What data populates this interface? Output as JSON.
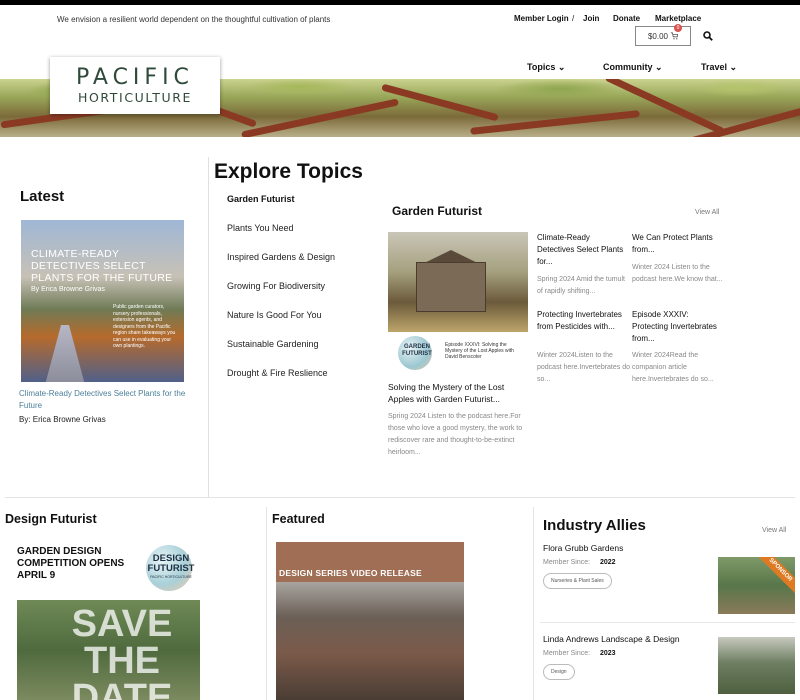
{
  "header": {
    "tagline": "We envision a resilient world dependent on the thoughtful cultivation of plants",
    "account": {
      "login": "Member Login",
      "separator": "/",
      "join": "Join",
      "donate": "Donate",
      "marketplace": "Marketplace"
    },
    "cart": {
      "amount": "$0.00",
      "count": "0",
      "icon": "cart-icon"
    },
    "search_icon": "search-icon"
  },
  "logo": {
    "line1": "PACIFIC",
    "line2": "HORTICULTURE"
  },
  "nav": [
    {
      "label": "Topics ⌄"
    },
    {
      "label": "Community ⌄"
    },
    {
      "label": "Travel ⌄"
    }
  ],
  "latest": {
    "heading": "Latest",
    "image": {
      "headline": "CLIMATE-READY DETECTIVES SELECT PLANTS FOR THE FUTURE",
      "byline": "By Erica Browne Grivas",
      "blurb": "Public garden curators, nursery professionals, extension agents, and designers from the Pacific region share takeaways you can use in evaluating your own plantings."
    },
    "title": "Climate-Ready Detectives Select Plants for the Future",
    "author": "By: Erica Browne Grivas"
  },
  "explore": {
    "heading": "Explore Topics",
    "topics": [
      "Garden Futurist",
      "Plants You Need",
      "Inspired Gardens & Design",
      "Growing For Biodiversity",
      "Nature Is Good For You",
      "Sustainable Gardening",
      "Drought & Fire Reslience"
    ]
  },
  "garden_futurist": {
    "heading": "Garden Futurist",
    "view_all": "View All",
    "main": {
      "episode_logo": "GARDEN FUTURIST",
      "episode_caption": "Episode XXXVI: Solving the Mystery of the Lost Apples with David Benscoter",
      "title": "Solving the Mystery of the Lost Apples with Garden Futurist...",
      "excerpt": "Spring 2024 Listen to the podcast here.For those who love a good mystery, the work to rediscover rare and thought-to-be-extinct heirloom..."
    },
    "items": [
      {
        "title": "Climate-Ready Detectives Select Plants for...",
        "excerpt": "Spring 2024 Amid the tumult of rapidly shifting..."
      },
      {
        "title": "We Can Protect Plants from...",
        "excerpt": "Winter 2024 Listen to the podcast here.We know that..."
      },
      {
        "title": "Protecting Invertebrates from Pesticides with...",
        "excerpt": "Winter 2024Listen to the podcast here.Invertebrates do so..."
      },
      {
        "title": "Episode XXXIV: Protecting Invertebrates from...",
        "excerpt": "Winter 2024Read the companion article here.Invertebrates do so..."
      }
    ]
  },
  "design_futurist": {
    "heading": "Design Futurist",
    "promo": "GARDEN DESIGN COMPETITION OPENS APRIL 9",
    "badge": "DESIGN FUTURIST",
    "badge_sub": "PACIFIC HORTICULTURE",
    "image_text": "SAVE THE DATE"
  },
  "featured": {
    "heading": "Featured",
    "image_label": "DESIGN SERIES VIDEO RELEASE"
  },
  "industry_allies": {
    "heading": "Industry Allies",
    "view_all": "View All",
    "member_since_label": "Member Since:",
    "sponsor_label": "SPONSOR",
    "allies": [
      {
        "name": "Flora Grubb Gardens",
        "since": "2022",
        "tag": "Nurseries & Plant Sales"
      },
      {
        "name": "Linda Andrews Landscape & Design",
        "since": "2023",
        "tag": "Design"
      }
    ]
  }
}
